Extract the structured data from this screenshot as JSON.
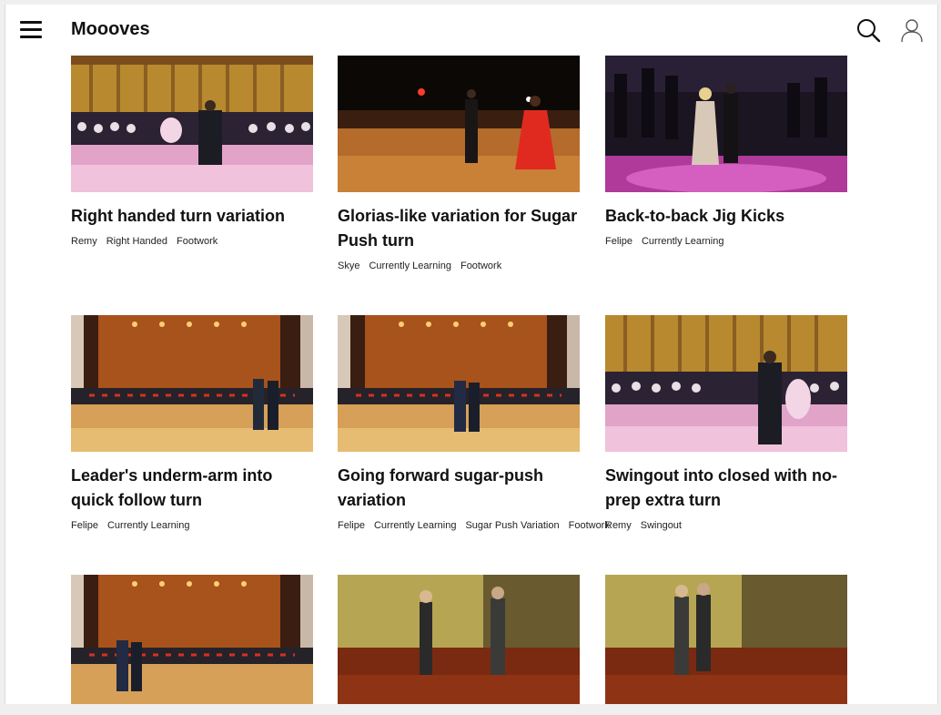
{
  "header": {
    "title": "Moooves",
    "menu_icon": "hamburger-menu-icon",
    "search_icon": "search-icon",
    "profile_icon": "user-icon"
  },
  "cards": [
    {
      "title": "Right handed turn variation",
      "tags": [
        "Remy",
        "Right Handed",
        "Footwork"
      ]
    },
    {
      "title": "Glorias-like variation for Sugar Push turn",
      "tags": [
        "Skye",
        "Currently Learning",
        "Footwork"
      ]
    },
    {
      "title": "Back-to-back Jig Kicks",
      "tags": [
        "Felipe",
        "Currently Learning"
      ]
    },
    {
      "title": "Leader's underm-arm into quick follow turn",
      "tags": [
        "Felipe",
        "Currently Learning"
      ]
    },
    {
      "title": "Going forward sugar-push variation",
      "tags": [
        "Felipe",
        "Currently Learning",
        "Sugar Push Variation",
        "Footwork"
      ]
    },
    {
      "title": "Swingout into closed with no-prep extra turn",
      "tags": [
        "Remy",
        "Swingout"
      ]
    },
    {
      "title": "",
      "tags": []
    },
    {
      "title": "",
      "tags": []
    },
    {
      "title": "",
      "tags": []
    }
  ]
}
